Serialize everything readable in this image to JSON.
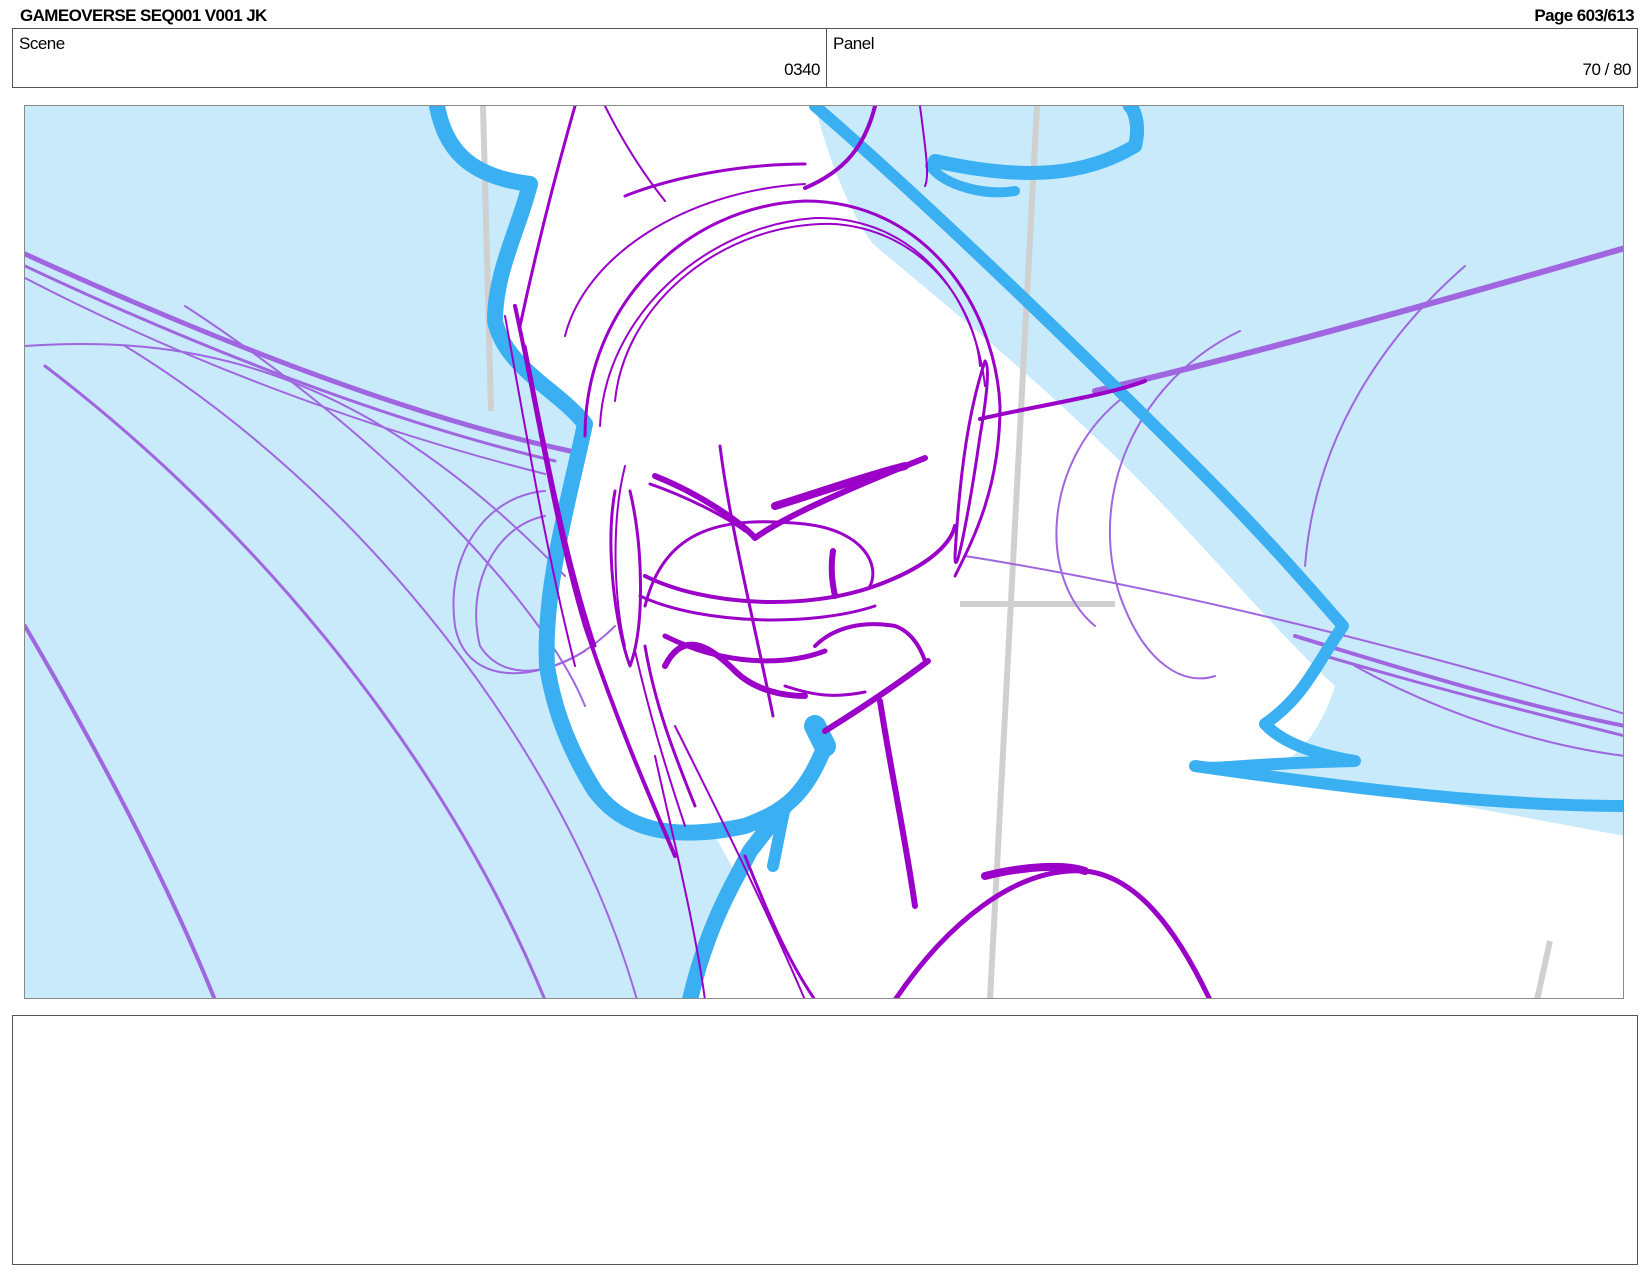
{
  "header": {
    "title": "GAMEOVERSE SEQ001 V001 JK",
    "page": "Page 603/613"
  },
  "info": {
    "scene_label": "Scene",
    "scene_value": "0340",
    "panel_label": "Panel",
    "panel_value": "70 / 80"
  },
  "sketch": {
    "icon": "storyboard-sketch-drawing",
    "colors": {
      "sky_fill": "#c8eafb",
      "cyan_stroke": "#3ab0f3",
      "purple_stroke": "#9a00c8",
      "lavender_stroke": "#a066e0",
      "guide_gray": "#d0d0d0"
    }
  },
  "notes": {
    "text": ""
  }
}
